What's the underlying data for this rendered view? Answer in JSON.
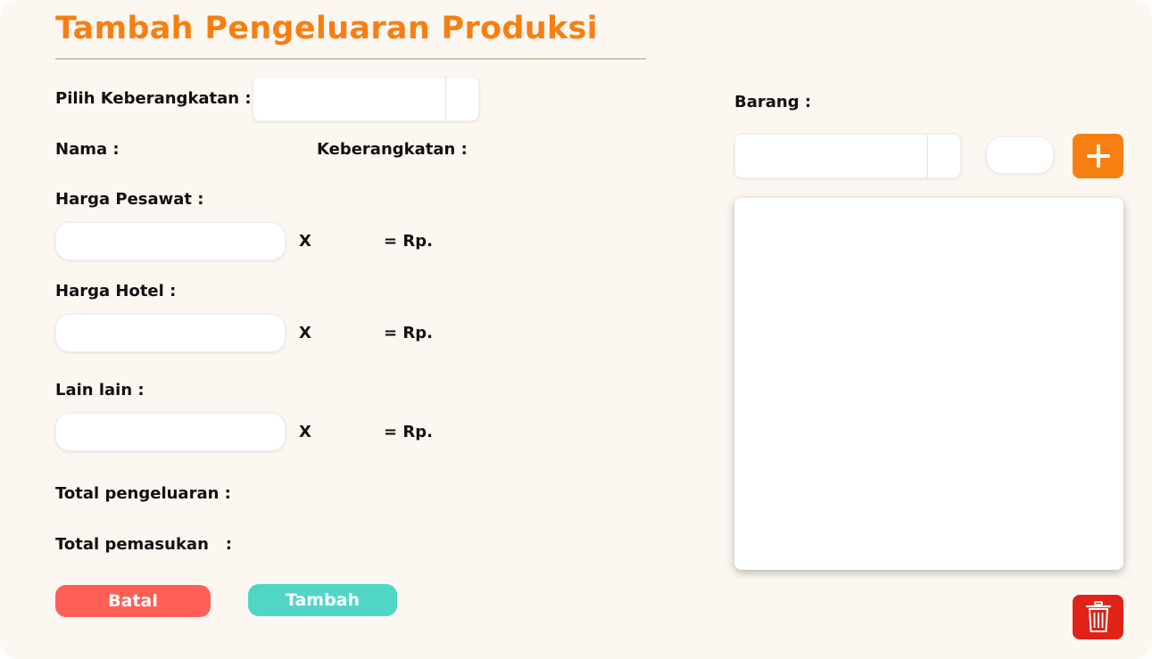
{
  "page": {
    "title": "Tambah Pengeluaran Produksi"
  },
  "form": {
    "pilih_label": "Pilih Keberangkatan :",
    "nama_label": "Nama :",
    "keberangkatan_label": "Keberangkatan :",
    "pesawat_label": "Harga Pesawat :",
    "hotel_label": "Harga Hotel :",
    "lain_label": "Lain lain :",
    "multiply": "X",
    "equals_rp": "= Rp.",
    "total_pengeluaran_label": "Total pengeluaran :",
    "total_pemasukan_label": "Total pemasukan   :"
  },
  "buttons": {
    "batal": "Batal",
    "tambah": "Tambah"
  },
  "barang": {
    "label": "Barang :"
  },
  "colors": {
    "accent": "#f77f11",
    "batal": "#ff5f57",
    "tambah": "#4fd6c6",
    "delete": "#e02218",
    "background": "#fdf7f2"
  },
  "icons": {
    "add": "plus-icon",
    "delete": "trash-icon"
  }
}
